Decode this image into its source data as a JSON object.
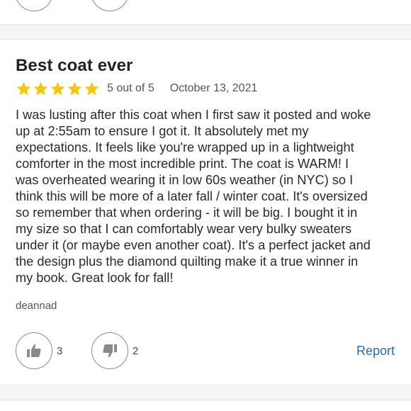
{
  "review": {
    "title": "Best coat ever",
    "rating": 5,
    "rating_text": "5 out of 5",
    "date": "October 13, 2021",
    "body": "I was lusting after this coat when I first saw it posted and woke\nup at 2:55am to ensure I got it. It absolutely met my\nexpectations. It feels like you're wrapped up in a lightweight\ncomforter in the most incredible print. The coat is WARM! I\nwas overheated wearing it in low 60s weather (in NYC) so I\nthink this will be more of a later fall / winter coat. It's oversized\nso remember that when ordering - it will be big. I bought it in\nmy size so that I can comfortably wear very bulky sweaters\nunder it (or maybe even another coat). It's a perfect jacket and\nthe design plus the diamond quilting make it a true winner in\nmy book. Great look for fall!",
    "author": "deannad",
    "helpful_count": "3",
    "unhelpful_count": "2",
    "report_label": "Report"
  },
  "icons": {
    "star": "star-icon",
    "thumbs_up": "thumbs-up-icon",
    "thumbs_down": "thumbs-down-icon"
  },
  "colors": {
    "star": "#f5c518",
    "link": "#2f6bb5",
    "icon": "#8a8a8a",
    "divider_band": "#f5f5f5"
  }
}
